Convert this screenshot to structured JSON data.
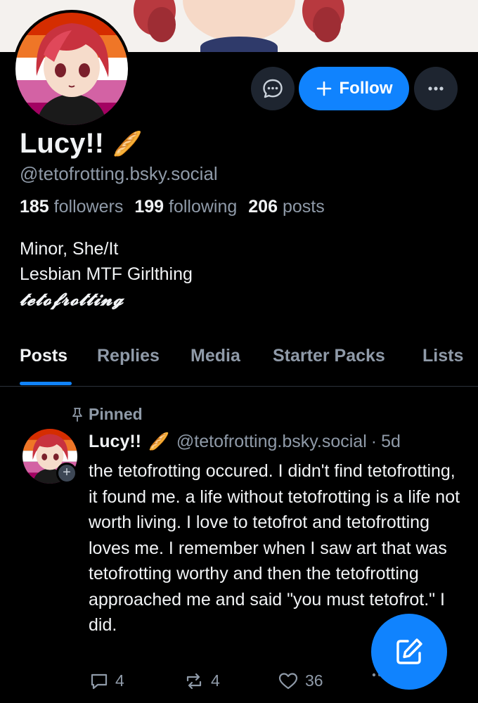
{
  "profile": {
    "display_name": "Lucy!!",
    "name_emoji": "🥖",
    "handle": "@tetofrotting.bsky.social",
    "stats": {
      "followers_count": "185",
      "followers_label": "followers",
      "following_count": "199",
      "following_label": "following",
      "posts_count": "206",
      "posts_label": "posts"
    },
    "bio": {
      "line1": "Minor, She/It",
      "line2": "Lesbian MTF Girlthing",
      "line3": "𝓽𝓮𝓽𝓸𝓯𝓻𝓸𝓽𝓽𝓲𝓷𝓰"
    }
  },
  "header_actions": {
    "follow_label": "Follow",
    "message_icon": "chat-bubble-icon",
    "more_icon": "ellipsis-icon"
  },
  "tabs": [
    {
      "label": "Posts",
      "active": true
    },
    {
      "label": "Replies",
      "active": false
    },
    {
      "label": "Media",
      "active": false
    },
    {
      "label": "Starter Packs",
      "active": false
    },
    {
      "label": "Lists",
      "active": false
    }
  ],
  "post": {
    "pinned_label": "Pinned",
    "author_name": "Lucy!!",
    "author_emoji": "🥖",
    "author_handle": "@tetofrotting.bsky.social",
    "separator": "·",
    "time_ago": "5d",
    "text": "the tetofrotting occured. I didn't find tetofrotting, it found me. a life without tetofrotting is a life not worth living. I love to tetofrot and tetofrotting loves me. I remember when I saw art that was tetofrotting worthy and then the tetofrotting approached me and said \"you must tetofrot.\" I did.",
    "reply_count": "4",
    "repost_count": "4",
    "like_count": "36"
  },
  "colors": {
    "accent": "#1083fe",
    "background": "#000000",
    "muted_text": "#8f9aa8",
    "flag_stripes": [
      "#d52d00",
      "#ef7627",
      "#ffffff",
      "#d362a4",
      "#a30262"
    ]
  }
}
